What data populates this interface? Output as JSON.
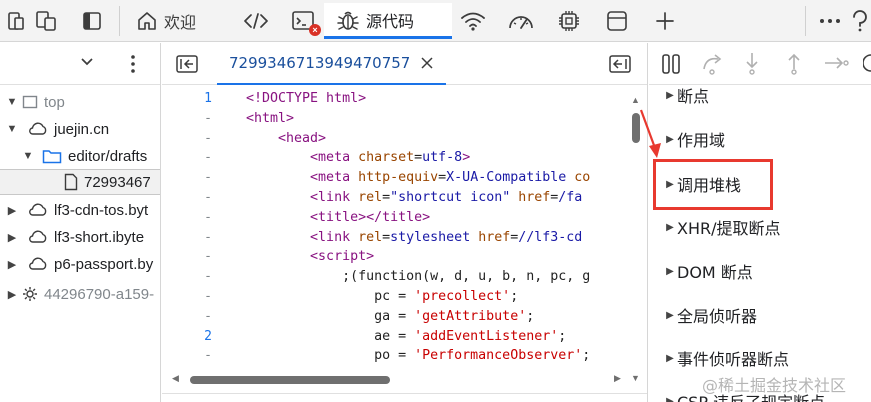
{
  "toolbar": {
    "tabs": [
      {
        "icon": "home-icon",
        "label": "欢迎"
      },
      {
        "icon": "elements-icon",
        "label": ""
      },
      {
        "icon": "console-icon",
        "label": "",
        "badge": "×"
      },
      {
        "icon": "bug-icon",
        "label": "源代码"
      },
      {
        "icon": "network-icon",
        "label": ""
      },
      {
        "icon": "performance-icon",
        "label": ""
      },
      {
        "icon": "memory-icon",
        "label": ""
      },
      {
        "icon": "application-icon",
        "label": ""
      }
    ],
    "active_tab": "源代码"
  },
  "navigator": {
    "items": [
      {
        "label": "top",
        "muted": true
      },
      {
        "label": "juejin.cn"
      },
      {
        "label": "editor/drafts"
      },
      {
        "label": "72993467"
      },
      {
        "label": "lf3-cdn-tos.byt"
      },
      {
        "label": "lf3-short.ibyte"
      },
      {
        "label": "p6-passport.by"
      },
      {
        "label": "44296790-a159-",
        "muted": true
      }
    ]
  },
  "editor": {
    "file_tab": "7299346713949470757",
    "line_markers": [
      "1",
      "-",
      "-",
      "-",
      "-",
      "-",
      "-",
      "-",
      "-",
      "-",
      "-",
      "-",
      "2",
      "-"
    ],
    "lines": [
      [
        [
          "k-tag",
          "<!DOCTYPE html>"
        ]
      ],
      [
        [
          "k-tag",
          "<html>"
        ]
      ],
      [
        [
          "k-plain",
          "    "
        ],
        [
          "k-tag",
          "<head>"
        ]
      ],
      [
        [
          "k-plain",
          "        "
        ],
        [
          "k-tag",
          "<meta "
        ],
        [
          "k-attr",
          "charset"
        ],
        [
          "k-plain",
          "="
        ],
        [
          "k-val",
          "utf-8"
        ],
        [
          "k-tag",
          ">"
        ]
      ],
      [
        [
          "k-plain",
          "        "
        ],
        [
          "k-tag",
          "<meta "
        ],
        [
          "k-attr",
          "http-equiv"
        ],
        [
          "k-plain",
          "="
        ],
        [
          "k-val",
          "X-UA-Compatible"
        ],
        [
          "k-plain",
          " "
        ],
        [
          "k-attr",
          "co"
        ]
      ],
      [
        [
          "k-plain",
          "        "
        ],
        [
          "k-tag",
          "<link "
        ],
        [
          "k-attr",
          "rel"
        ],
        [
          "k-plain",
          "="
        ],
        [
          "k-val",
          "\"shortcut icon\""
        ],
        [
          "k-plain",
          " "
        ],
        [
          "k-attr",
          "href"
        ],
        [
          "k-plain",
          "="
        ],
        [
          "k-val",
          "/fa"
        ]
      ],
      [
        [
          "k-plain",
          "        "
        ],
        [
          "k-tag",
          "<title></title>"
        ]
      ],
      [
        [
          "k-plain",
          "        "
        ],
        [
          "k-tag",
          "<link "
        ],
        [
          "k-attr",
          "rel"
        ],
        [
          "k-plain",
          "="
        ],
        [
          "k-val",
          "stylesheet"
        ],
        [
          "k-plain",
          " "
        ],
        [
          "k-attr",
          "href"
        ],
        [
          "k-plain",
          "="
        ],
        [
          "k-val",
          "//lf3-cd"
        ]
      ],
      [
        [
          "k-plain",
          "        "
        ],
        [
          "k-tag",
          "<script>"
        ]
      ],
      [
        [
          "k-plain",
          "            ;(function(w, d, u, b, n, pc, g"
        ]
      ],
      [
        [
          "k-plain",
          "                pc = "
        ],
        [
          "k-str",
          "'precollect'"
        ],
        [
          "k-plain",
          ";"
        ]
      ],
      [
        [
          "k-plain",
          "                ga = "
        ],
        [
          "k-str",
          "'getAttribute'"
        ],
        [
          "k-plain",
          ";"
        ]
      ],
      [
        [
          "k-plain",
          "                ae = "
        ],
        [
          "k-str",
          "'addEventListener'"
        ],
        [
          "k-plain",
          ";"
        ]
      ],
      [
        [
          "k-plain",
          "                po = "
        ],
        [
          "k-str",
          "'PerformanceObserver'"
        ],
        [
          "k-plain",
          ";"
        ]
      ]
    ]
  },
  "debugger": {
    "sections": [
      {
        "label": "断点"
      },
      {
        "label": "作用域"
      },
      {
        "label": "调用堆栈",
        "highlighted": true
      },
      {
        "label": "XHR/提取断点"
      },
      {
        "label": "DOM 断点"
      },
      {
        "label": "全局侦听器"
      },
      {
        "label": "事件侦听器断点"
      },
      {
        "label": "CSP 违反了规定断点"
      }
    ]
  },
  "watermark": "@稀土掘金技术社区",
  "colors": {
    "accent": "#1a73e8",
    "highlight": "#e8392f"
  }
}
